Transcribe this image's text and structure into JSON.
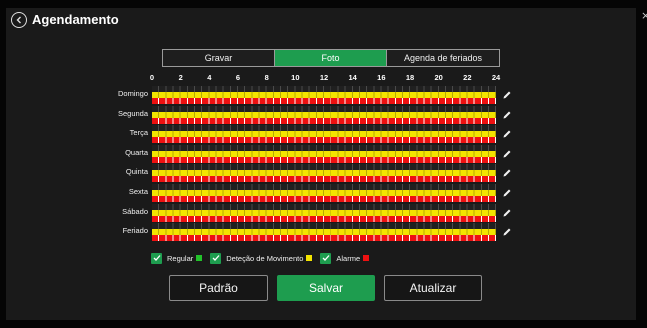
{
  "header": {
    "title": "Agendamento",
    "back_icon": "chevron-left-icon",
    "close_icon": "close-icon",
    "close_glyph": "×"
  },
  "tabs": [
    {
      "label": "Gravar",
      "active": false
    },
    {
      "label": "Foto",
      "active": true
    },
    {
      "label": "Agenda de feriados",
      "active": false
    }
  ],
  "schedule": {
    "hours": [
      "0",
      "2",
      "4",
      "6",
      "8",
      "10",
      "12",
      "14",
      "16",
      "18",
      "20",
      "22",
      "24"
    ],
    "days": [
      "Domingo",
      "Segunda",
      "Terça",
      "Quarta",
      "Quinta",
      "Sexta",
      "Sábado",
      "Feriado"
    ],
    "edit_icon": "pencil-icon"
  },
  "legend": [
    {
      "label": "Regular",
      "color": "#22c22a",
      "checked": true
    },
    {
      "label": "Deteção de Movimento",
      "color": "#f3e400",
      "checked": true
    },
    {
      "label": "Alarme",
      "color": "#ee1111",
      "checked": true
    }
  ],
  "buttons": {
    "default_label": "Padrão",
    "save_label": "Salvar",
    "refresh_label": "Atualizar"
  },
  "colors": {
    "accent": "#1e9d4f",
    "background": "#1a1a1a"
  }
}
